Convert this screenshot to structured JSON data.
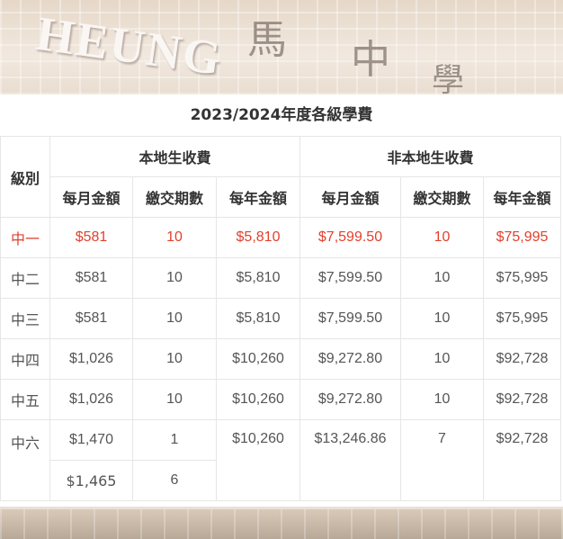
{
  "background": {
    "banner_text": "HEUNG",
    "banner_cjk": [
      "馬",
      "中",
      "學"
    ]
  },
  "table": {
    "caption": "2023/2024年度各級學費",
    "col_grade": "級別",
    "group_local": "本地生收費",
    "group_nonlocal": "非本地生收費",
    "sub_headers": [
      "每月金額",
      "繳交期數",
      "每年金額",
      "每月金額",
      "繳交期數",
      "每年金額"
    ],
    "highlight_color": "#e0412c",
    "rows": [
      {
        "grade": "中一",
        "l_month": "$581",
        "l_periods": "10",
        "l_year": "$5,810",
        "n_month": "$7,599.50",
        "n_periods": "10",
        "n_year": "$75,995"
      },
      {
        "grade": "中二",
        "l_month": "$581",
        "l_periods": "10",
        "l_year": "$5,810",
        "n_month": "$7,599.50",
        "n_periods": "10",
        "n_year": "$75,995"
      },
      {
        "grade": "中三",
        "l_month": "$581",
        "l_periods": "10",
        "l_year": "$5,810",
        "n_month": "$7,599.50",
        "n_periods": "10",
        "n_year": "$75,995"
      },
      {
        "grade": "中四",
        "l_month": "$1,026",
        "l_periods": "10",
        "l_year": "$10,260",
        "n_month": "$9,272.80",
        "n_periods": "10",
        "n_year": "$92,728"
      },
      {
        "grade": "中五",
        "l_month": "$1,026",
        "l_periods": "10",
        "l_year": "$10,260",
        "n_month": "$9,272.80",
        "n_periods": "10",
        "n_year": "$92,728"
      }
    ],
    "row6": {
      "grade": "中六",
      "l_month_a": "$1,470",
      "l_periods_a": "1",
      "l_month_b": "$1,465",
      "l_periods_b": "6",
      "l_year": "$10,260",
      "n_month": "$13,246.86",
      "n_periods": "7",
      "n_year": "$92,728"
    }
  }
}
